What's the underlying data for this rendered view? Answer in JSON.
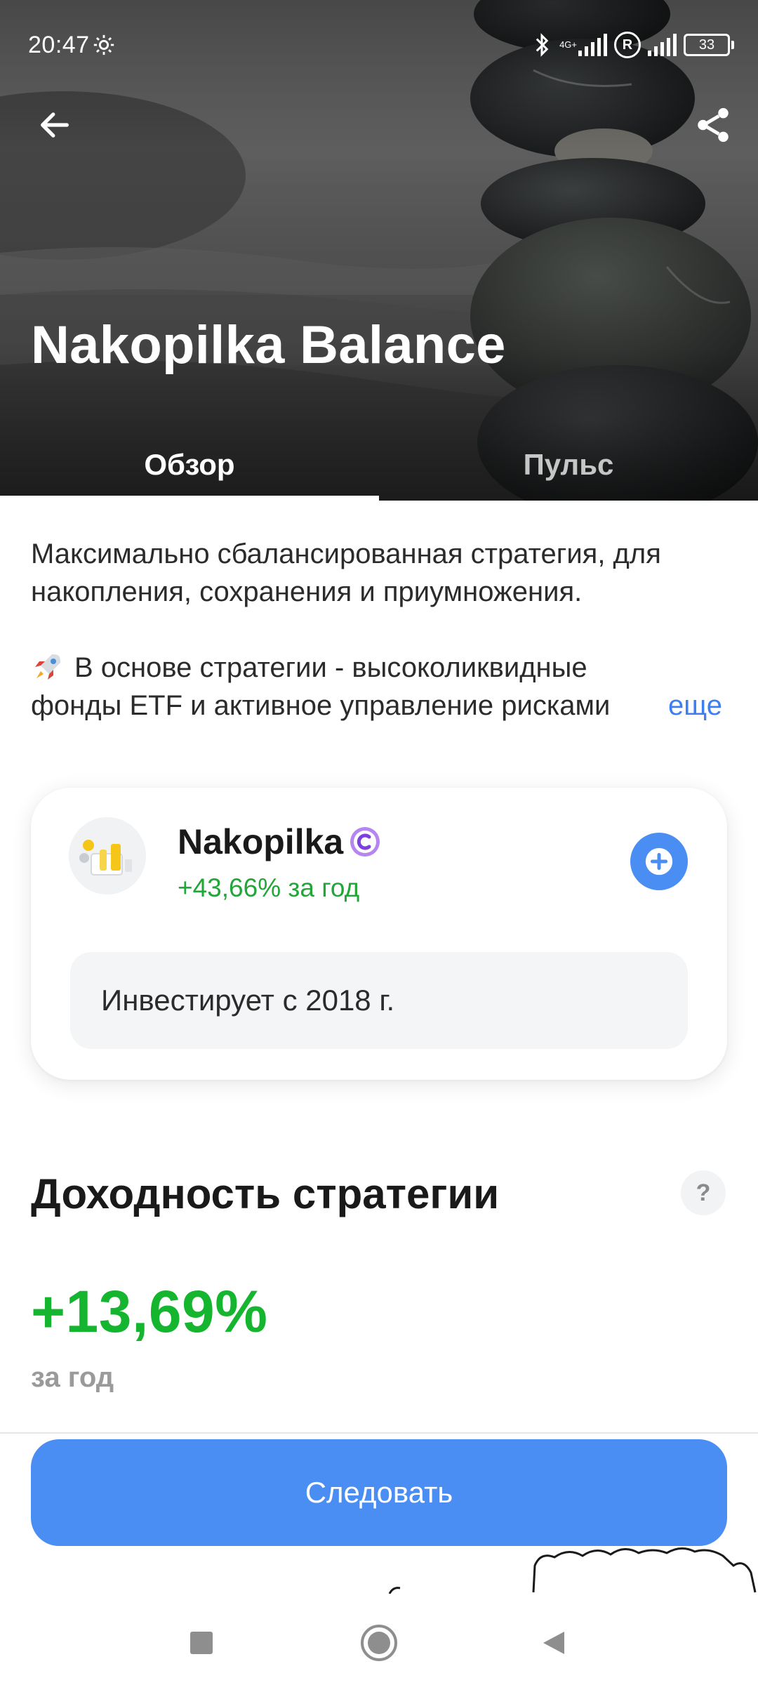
{
  "status_bar": {
    "time": "20:47",
    "network_tag": "4G+",
    "roaming_label": "R",
    "battery": "33",
    "icons": [
      "settings-gear-icon",
      "bluetooth-icon",
      "signal-icon",
      "battery-icon"
    ]
  },
  "header": {
    "title": "Nakopilka Balance",
    "back_icon": "arrow-left-icon",
    "share_icon": "share-icon"
  },
  "tabs": [
    {
      "label": "Обзор",
      "active": true
    },
    {
      "label": "Пульс",
      "active": false
    }
  ],
  "description": {
    "paragraph1": "Максимально сбалансированная стратегия, для накопления, сохранения и приумножения.",
    "paragraph2_line1": "В основе стратегии - высоколиквидные",
    "paragraph2_line2": "фонды ETF и активное управление рисками",
    "more_label": "еще",
    "emoji_icon": "rocket-icon"
  },
  "author_card": {
    "name": "Nakopilka",
    "return_text": "+43,66% за год",
    "since_text": "Инвестирует с 2018 г.",
    "badge_icon": "verified-badge-icon",
    "add_icon": "plus-circle-icon"
  },
  "profitability": {
    "title": "Доходность стратегии",
    "help_label": "?",
    "value": "+13,69%",
    "period": "за год"
  },
  "follow_button": {
    "label": "Следовать"
  },
  "nav_bar": {
    "items": [
      "recents-square-icon",
      "home-circle-icon",
      "back-triangle-icon"
    ]
  },
  "colors": {
    "accent_blue": "#4a8ef3",
    "link_blue": "#3d7ef0",
    "positive_green": "#16b52f",
    "author_green": "#21a638",
    "help_bg": "#f2f3f5"
  }
}
